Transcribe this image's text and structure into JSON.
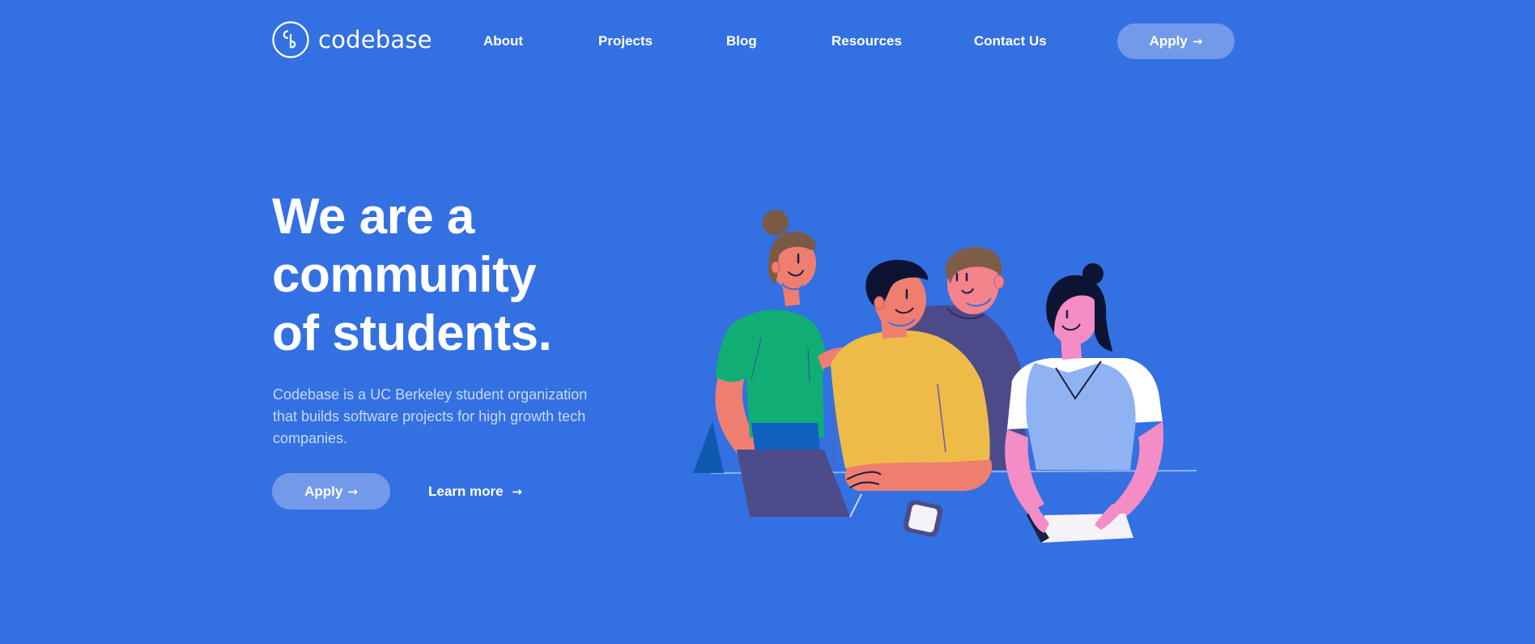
{
  "brand": {
    "name": "codebase",
    "logo_icon": "codebase-cb-logo-icon"
  },
  "nav": {
    "items": [
      {
        "label": "About"
      },
      {
        "label": "Projects"
      },
      {
        "label": "Blog"
      },
      {
        "label": "Resources"
      },
      {
        "label": "Contact Us"
      }
    ],
    "apply_label": "Apply",
    "apply_icon": "arrow-right-icon"
  },
  "hero": {
    "title_lines": [
      "We are a",
      "community",
      "of students."
    ],
    "description": "Codebase is a UC Berkeley student organization that builds software projects for high growth tech companies.",
    "apply_label": "Apply",
    "learn_more_label": "Learn more",
    "arrow_icon": "arrow-right-icon",
    "illustration": "students-collaborating-illustration"
  },
  "colors": {
    "background": "#3370e2",
    "button": "#7399ea",
    "muted_text": "#c9d8f6",
    "text": "#ffffff"
  }
}
